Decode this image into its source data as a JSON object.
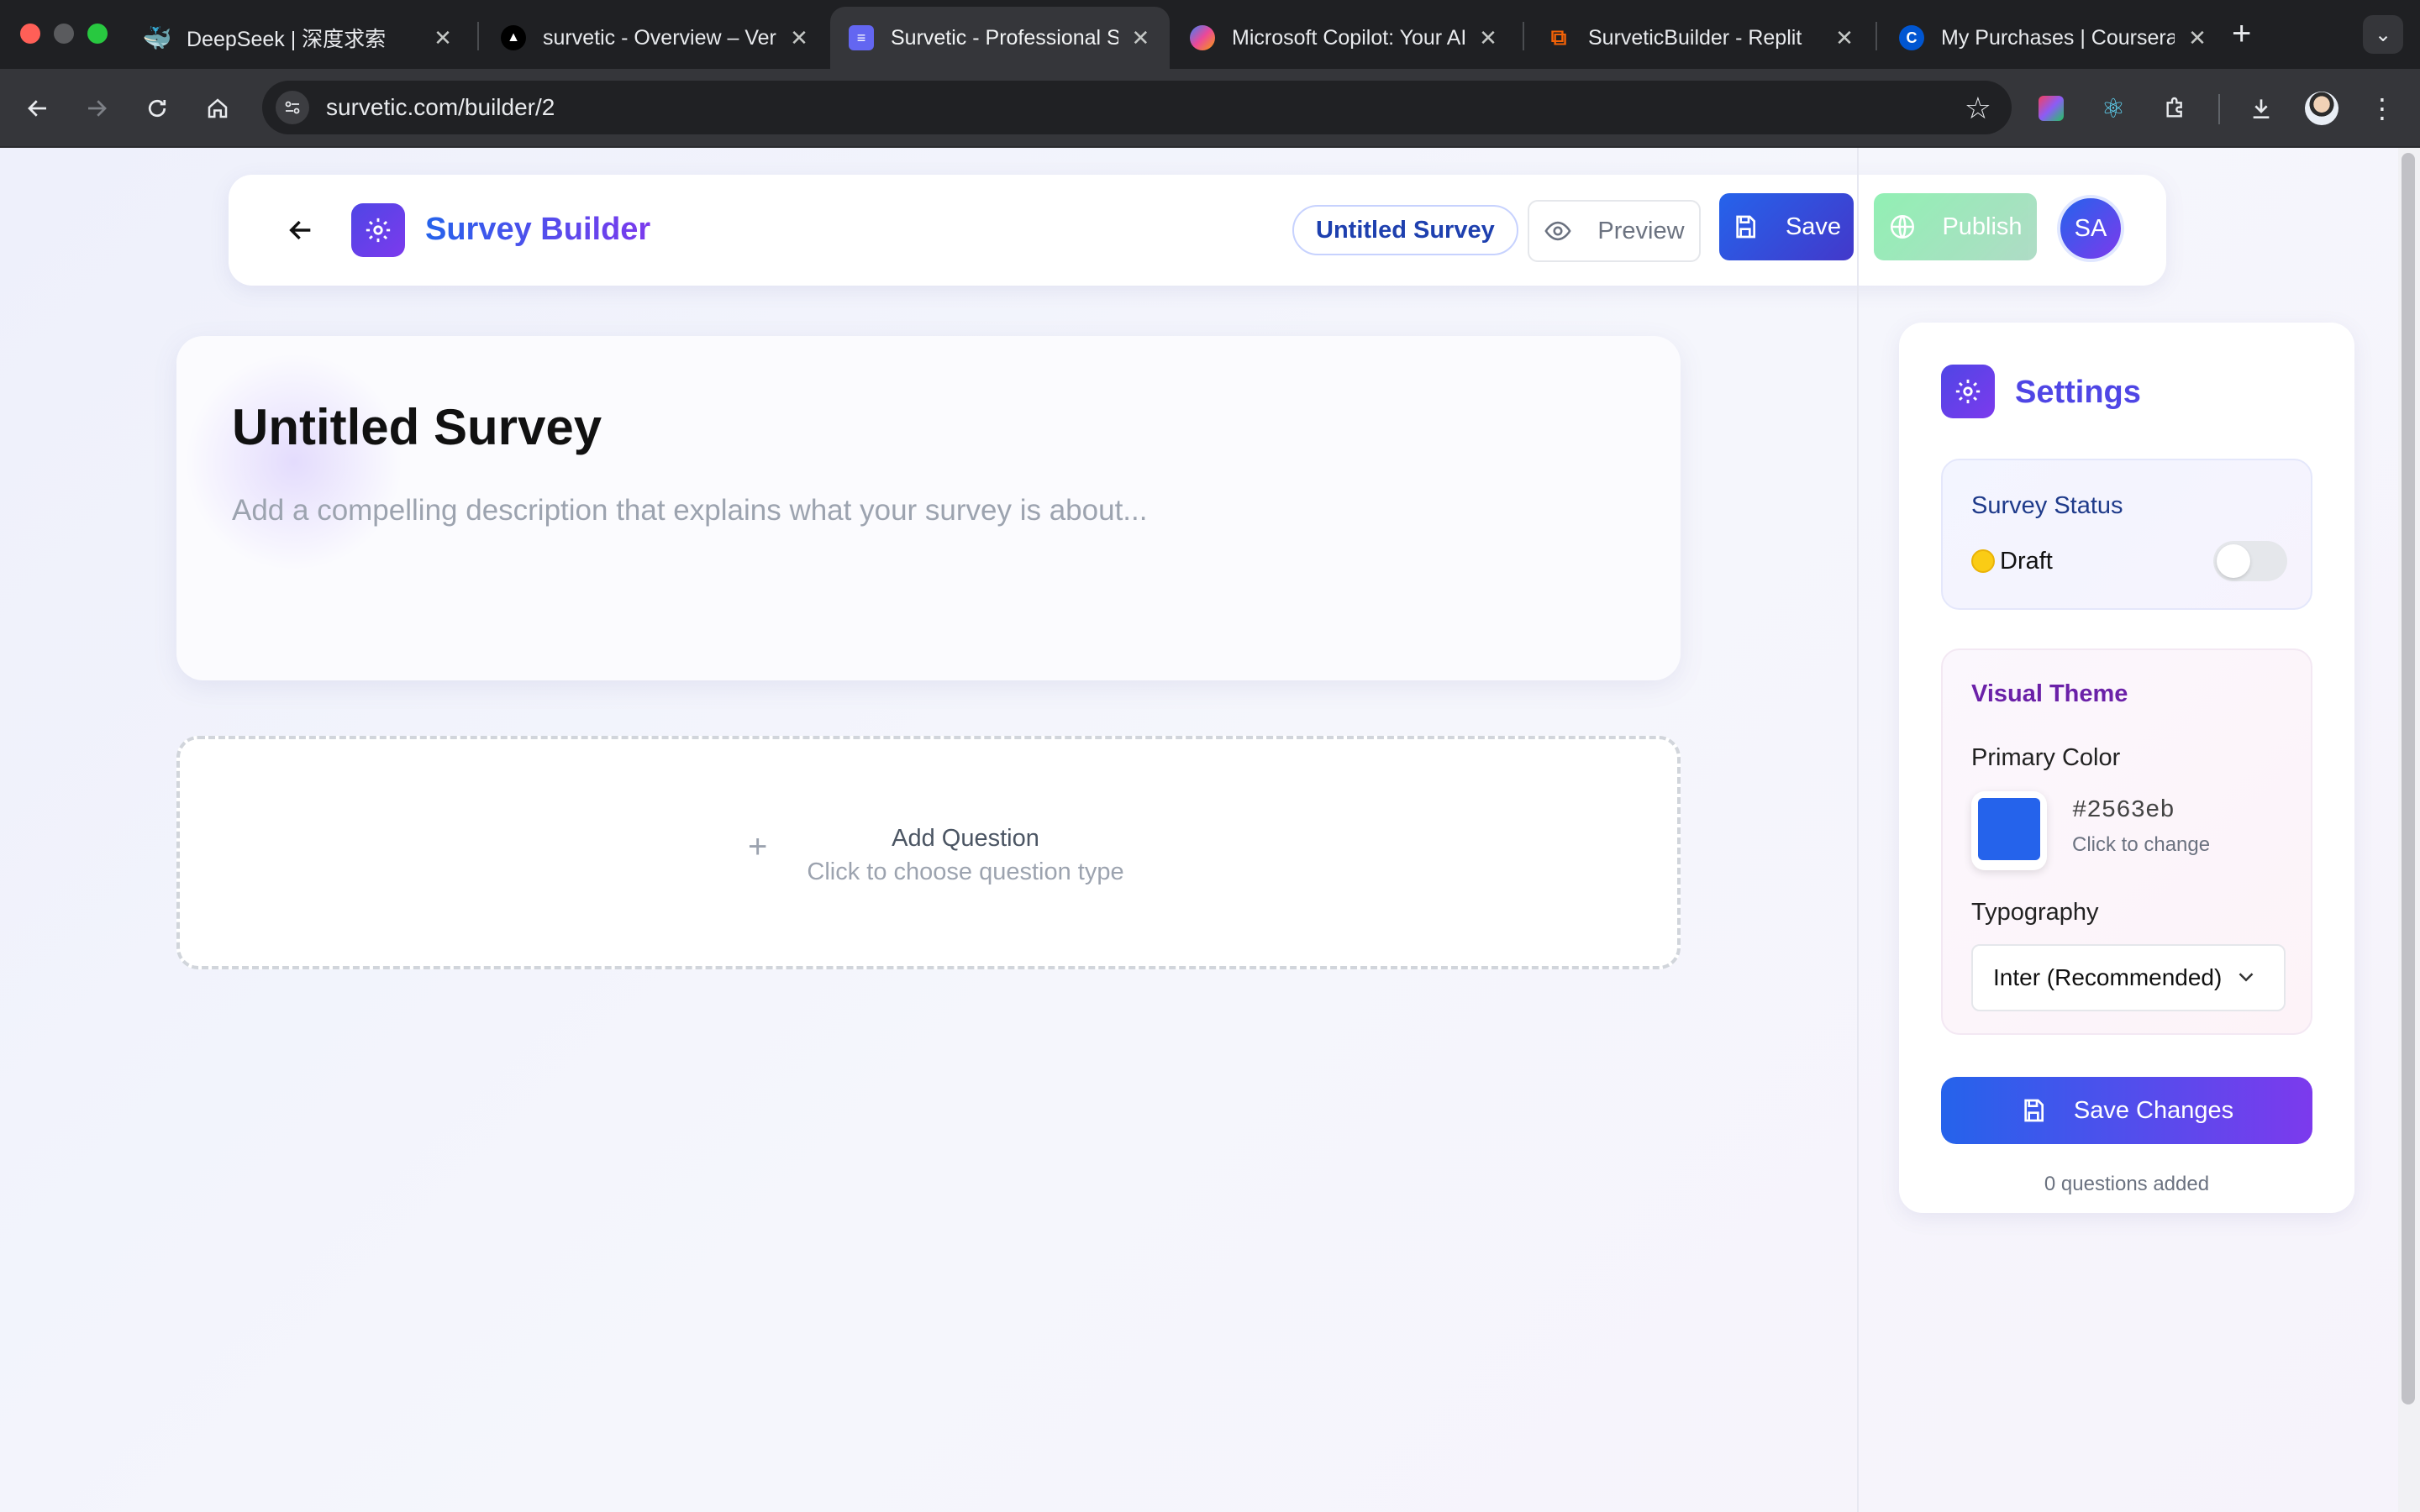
{
  "browser": {
    "tabs": [
      {
        "title": "DeepSeek | 深度求索",
        "icon": "deepseek-whale-icon"
      },
      {
        "title": "survetic - Overview – Vercel",
        "icon": "vercel-triangle-icon"
      },
      {
        "title": "Survetic - Professional Survey",
        "icon": "form-icon"
      },
      {
        "title": "Microsoft Copilot: Your AI",
        "icon": "copilot-icon"
      },
      {
        "title": "SurveticBuilder - Replit",
        "icon": "replit-icon"
      },
      {
        "title": "My Purchases | Coursera",
        "icon": "coursera-icon"
      }
    ],
    "active_tab_index": 2,
    "url": "survetic.com/builder/2"
  },
  "header": {
    "title": "Survey Builder",
    "survey_chip": "Untitled Survey",
    "preview_label": "Preview",
    "save_label": "Save",
    "publish_label": "Publish",
    "avatar_initials": "SA"
  },
  "survey": {
    "title": "Untitled Survey",
    "description_placeholder": "Add a compelling description that explains what your survey is about..."
  },
  "add_question": {
    "label": "Add Question",
    "hint": "Click to choose question type"
  },
  "settings": {
    "title": "Settings",
    "status": {
      "heading": "Survey Status",
      "value": "Draft",
      "published": false
    },
    "theme": {
      "heading": "Visual Theme",
      "primary_color_label": "Primary Color",
      "primary_color": "#2563eb",
      "primary_color_hint": "Click to change",
      "typography_label": "Typography",
      "typography_value": "Inter (Recommended)"
    },
    "save_changes_label": "Save Changes",
    "questions_added": "0 questions added"
  }
}
